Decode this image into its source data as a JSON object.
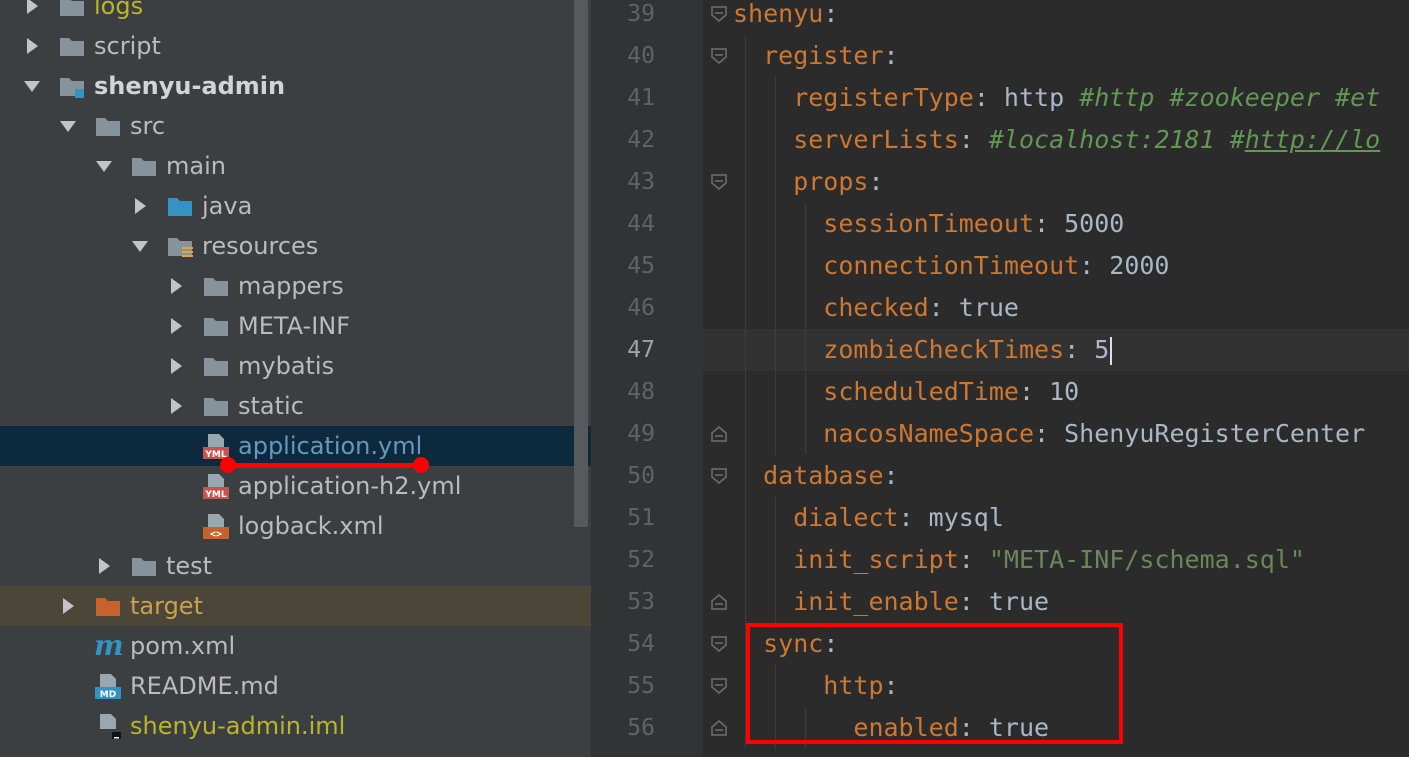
{
  "project_tree": {
    "items": [
      {
        "label": "logs",
        "icon": "folder-icon",
        "expanded": false,
        "style": "yellow"
      },
      {
        "label": "script",
        "icon": "folder-icon",
        "expanded": false,
        "style": "normal"
      },
      {
        "label": "shenyu-admin",
        "icon": "module-folder-icon",
        "expanded": true,
        "style": "bold"
      },
      {
        "label": "src",
        "icon": "folder-icon",
        "expanded": true,
        "style": "normal"
      },
      {
        "label": "main",
        "icon": "folder-icon",
        "expanded": true,
        "style": "normal"
      },
      {
        "label": "java",
        "icon": "source-folder-icon",
        "expanded": false,
        "style": "normal"
      },
      {
        "label": "resources",
        "icon": "resources-folder-icon",
        "expanded": true,
        "style": "normal"
      },
      {
        "label": "mappers",
        "icon": "folder-icon",
        "expanded": false,
        "style": "normal"
      },
      {
        "label": "META-INF",
        "icon": "folder-icon",
        "expanded": false,
        "style": "normal"
      },
      {
        "label": "mybatis",
        "icon": "folder-icon",
        "expanded": false,
        "style": "normal"
      },
      {
        "label": "static",
        "icon": "folder-icon",
        "expanded": false,
        "style": "normal"
      },
      {
        "label": "application.yml",
        "icon": "yml-file-icon",
        "expanded": null,
        "style": "blue",
        "selected": true
      },
      {
        "label": "application-h2.yml",
        "icon": "yml-file-icon",
        "expanded": null,
        "style": "normal"
      },
      {
        "label": "logback.xml",
        "icon": "xml-file-icon",
        "expanded": null,
        "style": "normal"
      },
      {
        "label": "test",
        "icon": "folder-icon",
        "expanded": false,
        "style": "normal"
      },
      {
        "label": "target",
        "icon": "excluded-folder-icon",
        "expanded": false,
        "style": "orange",
        "excluded": true
      },
      {
        "label": "pom.xml",
        "icon": "maven-icon",
        "expanded": null,
        "style": "normal"
      },
      {
        "label": "README.md",
        "icon": "markdown-file-icon",
        "expanded": null,
        "style": "normal"
      },
      {
        "label": "shenyu-admin.iml",
        "icon": "iml-file-icon",
        "expanded": null,
        "style": "yellow"
      }
    ]
  },
  "editor": {
    "current_line": 47,
    "lines": [
      {
        "n": "39",
        "tokens": [
          {
            "t": "key",
            "v": "shenyu"
          },
          {
            "t": "punct",
            "v": ":"
          }
        ]
      },
      {
        "n": "40",
        "tokens": [
          {
            "t": "key",
            "v": "register"
          },
          {
            "t": "punct",
            "v": ":"
          }
        ]
      },
      {
        "n": "41",
        "tokens": [
          {
            "t": "key",
            "v": "registerType"
          },
          {
            "t": "punct",
            "v": ": "
          },
          {
            "t": "val",
            "v": "http "
          },
          {
            "t": "cmt",
            "v": "#http #zookeeper #et"
          }
        ]
      },
      {
        "n": "42",
        "tokens": [
          {
            "t": "key",
            "v": "serverLists"
          },
          {
            "t": "punct",
            "v": ": "
          },
          {
            "t": "cmt",
            "v": "#localhost:2181 #"
          },
          {
            "t": "cmtu",
            "v": "http://lo"
          }
        ]
      },
      {
        "n": "43",
        "tokens": [
          {
            "t": "key",
            "v": "props"
          },
          {
            "t": "punct",
            "v": ":"
          }
        ]
      },
      {
        "n": "44",
        "tokens": [
          {
            "t": "key",
            "v": "sessionTimeout"
          },
          {
            "t": "punct",
            "v": ": "
          },
          {
            "t": "num",
            "v": "5000"
          }
        ]
      },
      {
        "n": "45",
        "tokens": [
          {
            "t": "key",
            "v": "connectionTimeout"
          },
          {
            "t": "punct",
            "v": ": "
          },
          {
            "t": "num",
            "v": "2000"
          }
        ]
      },
      {
        "n": "46",
        "tokens": [
          {
            "t": "key",
            "v": "checked"
          },
          {
            "t": "punct",
            "v": ": "
          },
          {
            "t": "val",
            "v": "true"
          }
        ]
      },
      {
        "n": "47",
        "tokens": [
          {
            "t": "key",
            "v": "zombieCheckTimes"
          },
          {
            "t": "punct",
            "v": ": "
          },
          {
            "t": "num",
            "v": "5"
          }
        ]
      },
      {
        "n": "48",
        "tokens": [
          {
            "t": "key",
            "v": "scheduledTime"
          },
          {
            "t": "punct",
            "v": ": "
          },
          {
            "t": "num",
            "v": "10"
          }
        ]
      },
      {
        "n": "49",
        "tokens": [
          {
            "t": "key",
            "v": "nacosNameSpace"
          },
          {
            "t": "punct",
            "v": ": "
          },
          {
            "t": "val",
            "v": "ShenyuRegisterCenter"
          }
        ]
      },
      {
        "n": "50",
        "tokens": [
          {
            "t": "key",
            "v": "database"
          },
          {
            "t": "punct",
            "v": ":"
          }
        ]
      },
      {
        "n": "51",
        "tokens": [
          {
            "t": "key",
            "v": "dialect"
          },
          {
            "t": "punct",
            "v": ": "
          },
          {
            "t": "val",
            "v": "mysql"
          }
        ]
      },
      {
        "n": "52",
        "tokens": [
          {
            "t": "key",
            "v": "init_script"
          },
          {
            "t": "punct",
            "v": ": "
          },
          {
            "t": "str",
            "v": "\"META-INF/schema.sql\""
          }
        ]
      },
      {
        "n": "53",
        "tokens": [
          {
            "t": "key",
            "v": "init_enable"
          },
          {
            "t": "punct",
            "v": ": "
          },
          {
            "t": "val",
            "v": "true"
          }
        ]
      },
      {
        "n": "54",
        "tokens": [
          {
            "t": "key",
            "v": "sync"
          },
          {
            "t": "punct",
            "v": ":"
          }
        ]
      },
      {
        "n": "55",
        "tokens": [
          {
            "t": "key",
            "v": "http"
          },
          {
            "t": "punct",
            "v": ":"
          }
        ]
      },
      {
        "n": "56",
        "tokens": [
          {
            "t": "key",
            "v": "enabled"
          },
          {
            "t": "punct",
            "v": ": "
          },
          {
            "t": "val",
            "v": "true"
          }
        ]
      }
    ]
  },
  "annotations": {
    "underline_color": "#ff0000",
    "box_color": "#ff0000"
  }
}
